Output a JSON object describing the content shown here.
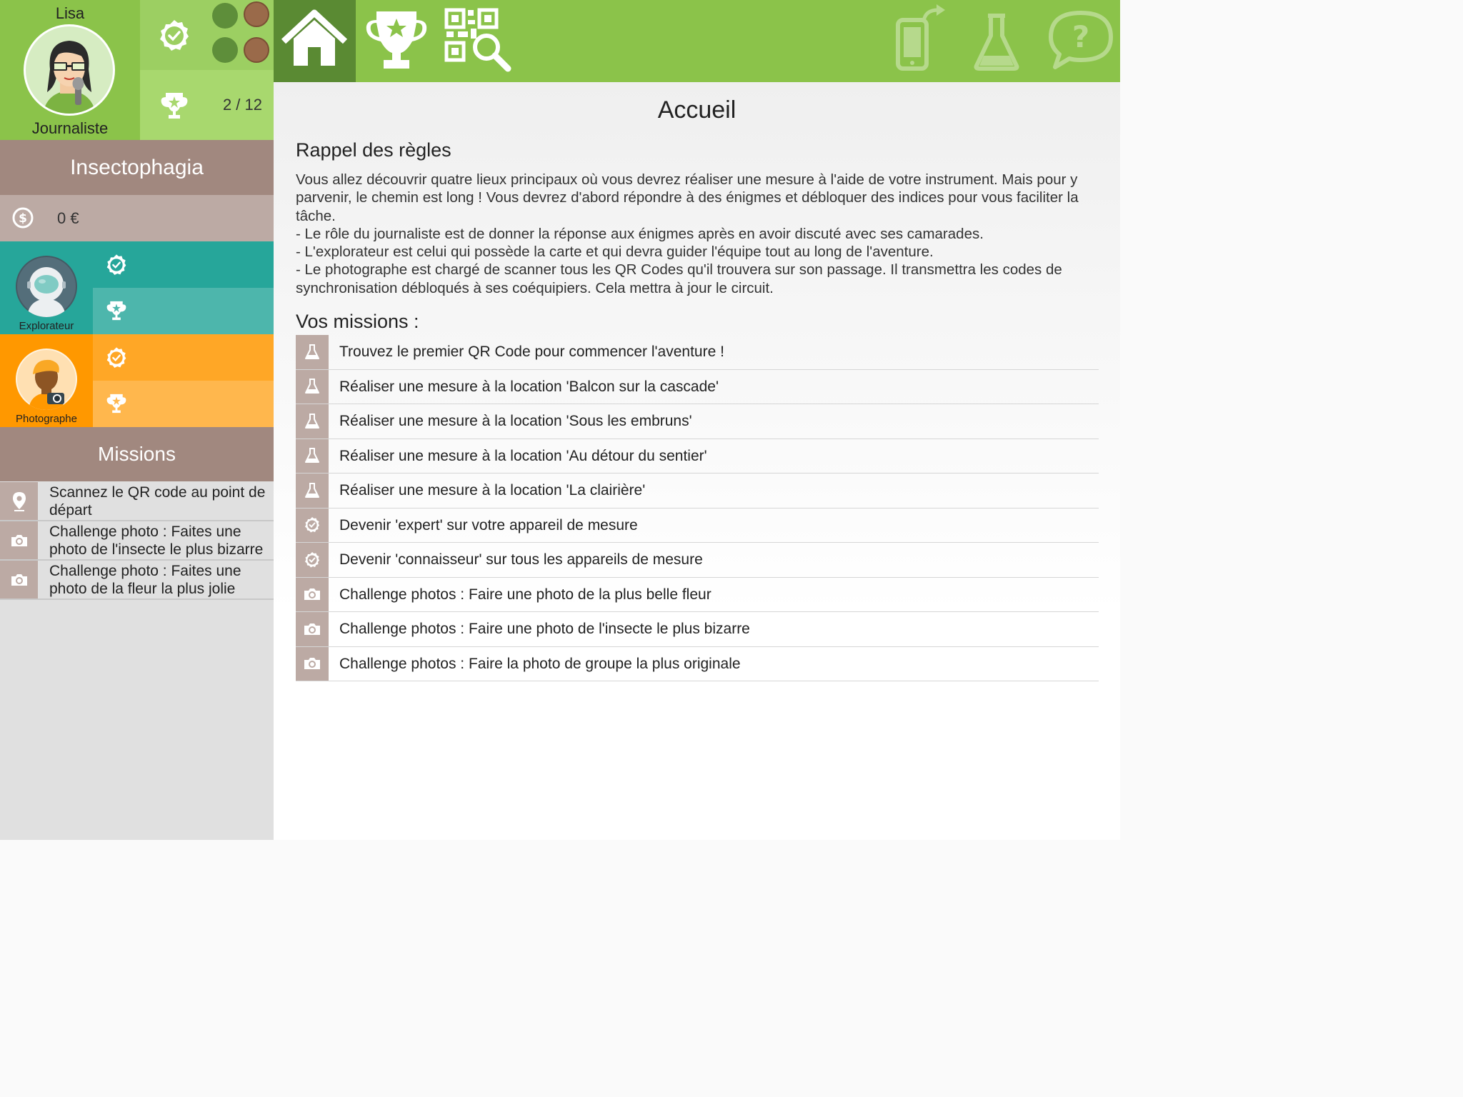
{
  "player": {
    "name": "Lisa",
    "role": "Journaliste",
    "trophies": "2 / 12"
  },
  "team": {
    "name": "Insectophagia",
    "money": "0 €"
  },
  "teammates": [
    {
      "role": "Explorateur",
      "color": "#26a69a"
    },
    {
      "role": "Photographe",
      "color": "#ff9800"
    }
  ],
  "sidebar_missions": {
    "title": "Missions",
    "items": [
      {
        "icon": "map-pin-icon",
        "text": "Scannez le QR code au point de départ"
      },
      {
        "icon": "camera-icon",
        "text": "Challenge photo : Faites une photo de l'insecte le plus bizarre"
      },
      {
        "icon": "camera-icon",
        "text": "Challenge photo : Faites une photo de la fleur la plus jolie"
      }
    ]
  },
  "nav": {
    "items": [
      "home-icon",
      "trophy-icon",
      "qr-search-icon",
      "phone-sync-icon",
      "flask-icon",
      "help-icon"
    ],
    "active": "home-icon"
  },
  "main": {
    "title": "Accueil",
    "rules_title": "Rappel des règles",
    "rules_lines": [
      "Vous allez découvrir quatre lieux principaux où vous devrez réaliser une mesure à l'aide de votre instrument. Mais pour y parvenir, le chemin est long ! Vous devrez d'abord répondre à des énigmes et débloquer des indices pour vous faciliter la tâche.",
      "- Le rôle du journaliste est de donner la réponse aux énigmes après en avoir discuté avec ses camarades.",
      "- L'explorateur est celui qui possède la carte et qui devra guider l'équipe tout au long de l'aventure.",
      "- Le photographe est chargé de scanner tous les QR Codes qu'il trouvera sur son passage. Il transmettra les codes de synchronisation débloqués à ses coéquipiers. Cela mettra à jour le circuit."
    ],
    "missions_title": "Vos missions :",
    "missions": [
      {
        "icon": "flask-icon",
        "text": "Trouvez le premier QR Code pour commencer l'aventure !"
      },
      {
        "icon": "flask-icon",
        "text": "Réaliser une mesure à la location 'Balcon sur la cascade'"
      },
      {
        "icon": "flask-icon",
        "text": "Réaliser une mesure à la location 'Sous les embruns'"
      },
      {
        "icon": "flask-icon",
        "text": "Réaliser une mesure à la location 'Au détour du sentier'"
      },
      {
        "icon": "flask-icon",
        "text": "Réaliser une mesure à la location 'La clairière'"
      },
      {
        "icon": "check-badge-icon",
        "text": "Devenir 'expert' sur votre appareil de mesure"
      },
      {
        "icon": "check-badge-icon",
        "text": "Devenir 'connaisseur' sur tous les appareils de mesure"
      },
      {
        "icon": "camera-icon",
        "text": "Challenge photos : Faire une photo de la plus belle fleur"
      },
      {
        "icon": "camera-icon",
        "text": "Challenge photos : Faire une photo de l'insecte le plus bizarre"
      },
      {
        "icon": "camera-icon",
        "text": "Challenge photos : Faire la photo de groupe la plus originale"
      }
    ]
  },
  "colors": {
    "green": "#8bc34a",
    "green_dark": "#5a8a33",
    "brown": "#a1887f",
    "brown_light": "#bcaaa4",
    "teal": "#26a69a",
    "orange": "#ff9800"
  }
}
